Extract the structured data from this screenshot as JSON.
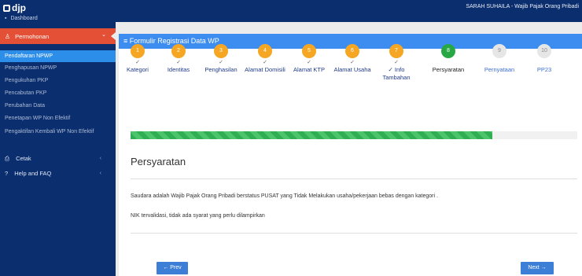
{
  "app": {
    "logo_text": "djp",
    "user_text": "SARAH SUHAILA - Wajib Pajak Orang Pribadi"
  },
  "sidebar": {
    "dashboard_label": "Dashboard",
    "permohonan_label": "Permohonan",
    "subitems": [
      "Pendaftaran NPWP",
      "Penghapusan NPWP",
      "Pengukuhan PKP",
      "Pencabutan PKP",
      "Perubahan Data",
      "Penetapan WP Non Efektif",
      "Pengaktifan Kembali WP Non Efektif"
    ],
    "cetak_label": "Cetak",
    "help_label": "Help and FAQ"
  },
  "form": {
    "title": "Formulir Registrasi Data WP",
    "steps": [
      {
        "num": "1",
        "label": "Kategori",
        "check": "✓",
        "state": "done"
      },
      {
        "num": "2",
        "label": "Identitas",
        "check": "✓",
        "state": "done"
      },
      {
        "num": "3",
        "label": "Penghasilan",
        "check": "✓",
        "state": "done"
      },
      {
        "num": "4",
        "label": "Alamat Domisili",
        "check": "✓",
        "state": "done"
      },
      {
        "num": "5",
        "label": "Alamat KTP",
        "check": "✓",
        "state": "done"
      },
      {
        "num": "6",
        "label": "Alamat Usaha",
        "check": "✓",
        "state": "done"
      },
      {
        "num": "7",
        "label": "✓ Info Tambahan",
        "check": "✓",
        "state": "done"
      },
      {
        "num": "8",
        "label": "Persyaratan",
        "check": "",
        "state": "current"
      },
      {
        "num": "9",
        "label": "Pernyataan",
        "check": "",
        "state": "todo"
      },
      {
        "num": "10",
        "label": "PP23",
        "check": "",
        "state": "todo"
      }
    ],
    "progress_fraction": 0.81,
    "section_title": "Persyaratan",
    "paragraph1": "Saudara adalah Wajib Pajak Orang Pribadi berstatus PUSAT yang Tidak Melakukan usaha/pekerjaan bebas dengan kategori .",
    "paragraph2": "NIK tervalidasi, tidak ada syarat yang perlu dilampirkan",
    "prev_label": "Prev",
    "next_label": "Next"
  },
  "colors": {
    "sidebar": "#0b2e6e",
    "accent_red": "#e35036",
    "accent_blue": "#3d8df0",
    "step_done": "#f5a623",
    "step_current": "#28a745",
    "step_todo": "#e6e6e6"
  }
}
